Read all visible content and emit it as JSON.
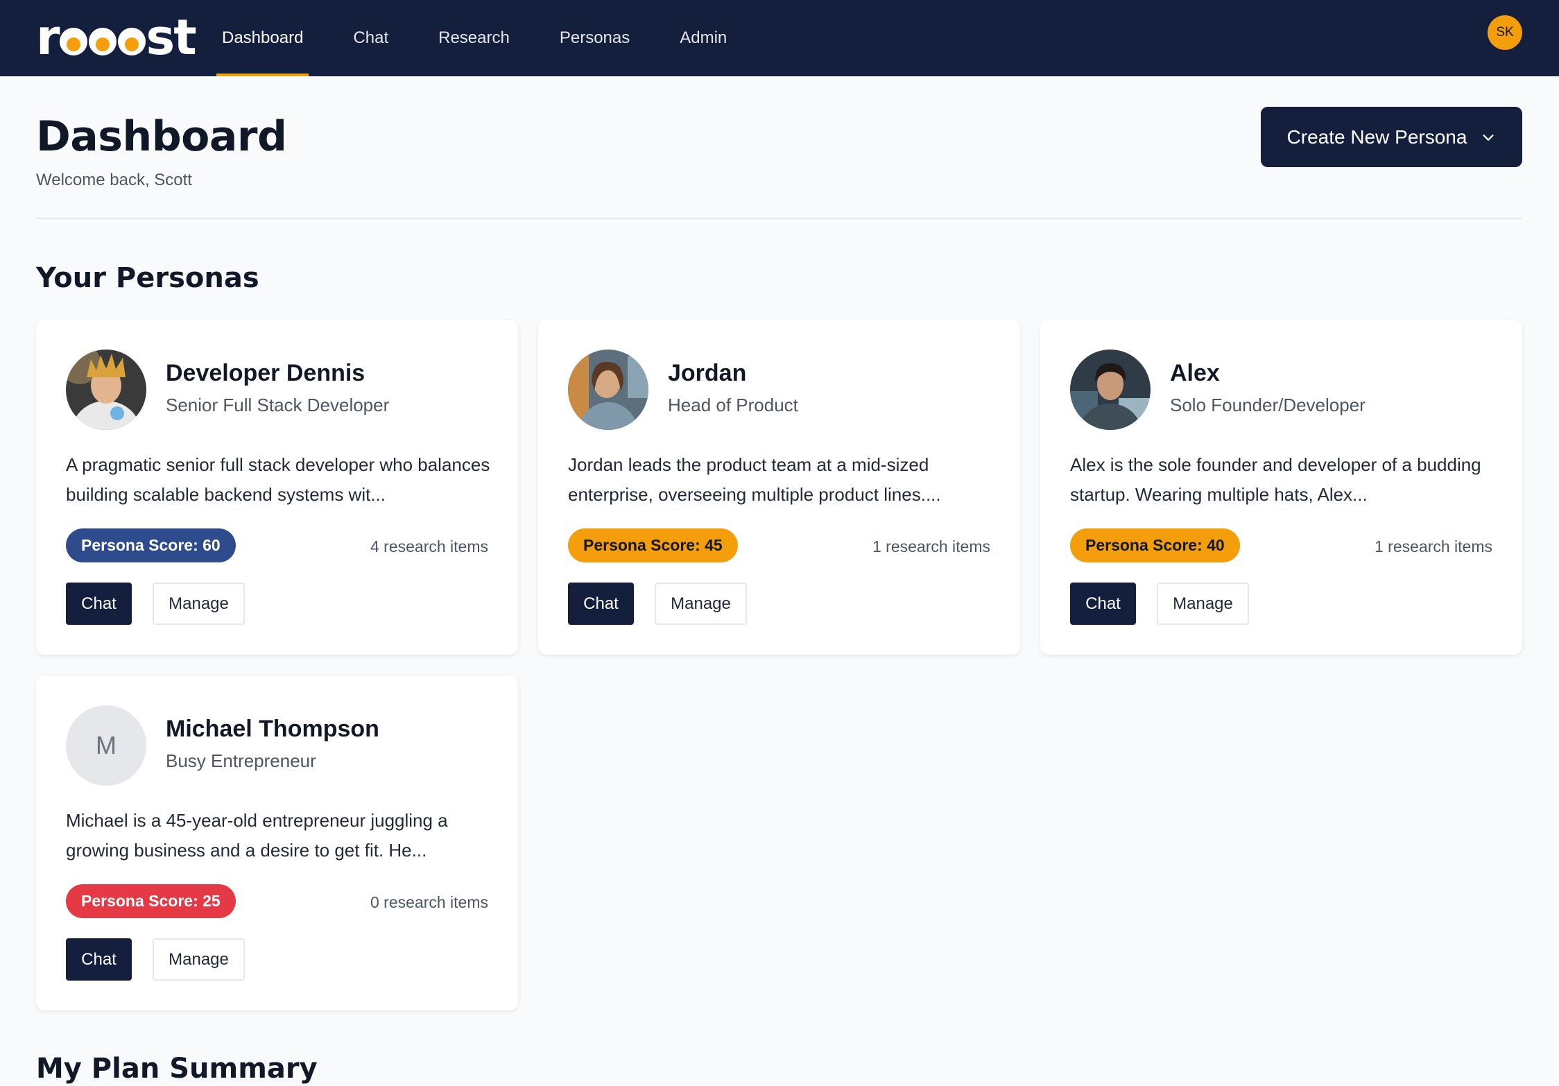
{
  "nav": {
    "logo": "rooost",
    "items": [
      {
        "label": "Dashboard",
        "active": true
      },
      {
        "label": "Chat",
        "active": false
      },
      {
        "label": "Research",
        "active": false
      },
      {
        "label": "Personas",
        "active": false
      },
      {
        "label": "Admin",
        "active": false
      }
    ],
    "user_initials": "SK"
  },
  "header": {
    "title": "Dashboard",
    "welcome": "Welcome back, Scott",
    "create_button": "Create New Persona"
  },
  "personas_section": {
    "title": "Your Personas"
  },
  "personas": [
    {
      "name": "Developer Dennis",
      "role": "Senior Full Stack Developer",
      "description": "A pragmatic senior full stack developer who balances building scalable backend systems wit...",
      "score_label": "Persona Score: 60",
      "score_color": "blue",
      "research": "4 research items",
      "chat_label": "Chat",
      "manage_label": "Manage"
    },
    {
      "name": "Jordan",
      "role": "Head of Product",
      "description": "Jordan leads the product team at a mid-sized enterprise, overseeing multiple product lines....",
      "score_label": "Persona Score: 45",
      "score_color": "amber",
      "research": "1 research items",
      "chat_label": "Chat",
      "manage_label": "Manage"
    },
    {
      "name": "Alex",
      "role": "Solo Founder/Developer",
      "description": "Alex is the sole founder and developer of a budding startup. Wearing multiple hats, Alex...",
      "score_label": "Persona Score: 40",
      "score_color": "amber",
      "research": "1 research items",
      "chat_label": "Chat",
      "manage_label": "Manage"
    },
    {
      "name": "Michael Thompson",
      "role": "Busy Entrepreneur",
      "initial": "M",
      "description": "Michael is a 45-year-old entrepreneur juggling a growing business and a desire to get fit. He...",
      "score_label": "Persona Score: 25",
      "score_color": "red",
      "research": "0 research items",
      "chat_label": "Chat",
      "manage_label": "Manage"
    }
  ],
  "plan_section": {
    "title": "My Plan Summary"
  },
  "colors": {
    "nav_bg": "#131f3d",
    "accent": "#f59e0b",
    "score_blue": "#2e4b8c",
    "score_red": "#e53946"
  }
}
